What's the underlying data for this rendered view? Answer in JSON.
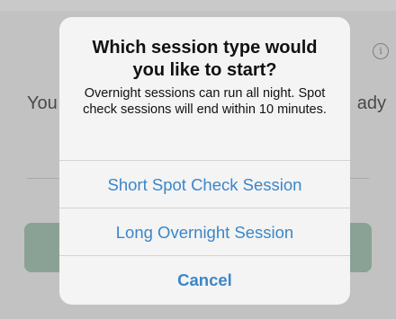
{
  "background": {
    "info_icon_glyph": "i",
    "text_left": "You",
    "text_right": "ady"
  },
  "alert": {
    "title": "Which session type would you like to start?",
    "message": "Overnight sessions can run all night. Spot check sessions will end within 10 minutes.",
    "actions": [
      {
        "label": "Short Spot Check Session"
      },
      {
        "label": "Long Overnight Session"
      },
      {
        "label": "Cancel"
      }
    ]
  },
  "colors": {
    "accent": "#3b86c8",
    "background_button": "#a9c6b6"
  }
}
